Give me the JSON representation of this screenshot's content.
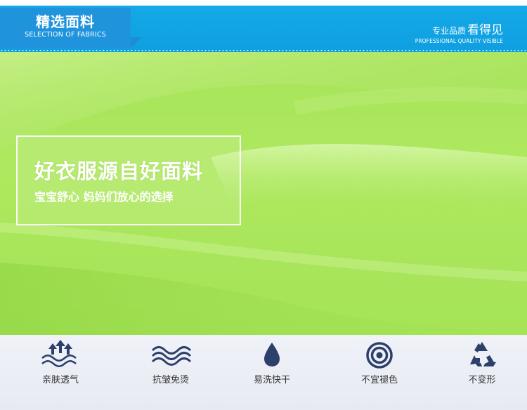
{
  "header": {
    "section_title": "精选面料",
    "section_subtitle": "SELECTION OF FABRICS",
    "brand_small": "专业品质",
    "brand_big": "看得见",
    "brand_english": "PROFESSIONAL QUALITY VISIBLE"
  },
  "hero": {
    "headline": "好衣服源自好面料",
    "subline": "宝宝舒心 妈妈们放心的选择"
  },
  "features": [
    {
      "label": "亲肤透气",
      "icon": "breathable-wave-arrows-icon"
    },
    {
      "label": "抗皱免烫",
      "icon": "wrinkle-wave-icon"
    },
    {
      "label": "易洗快干",
      "icon": "water-drop-icon"
    },
    {
      "label": "不宜褪色",
      "icon": "concentric-target-icon"
    },
    {
      "label": "不变形",
      "icon": "recycle-icon"
    }
  ],
  "colors": {
    "header_blue": "#14a9e8",
    "fabric_green": "#a8e55a",
    "icon_navy": "#2d3f6b",
    "strip_bg": "#eceff6"
  }
}
